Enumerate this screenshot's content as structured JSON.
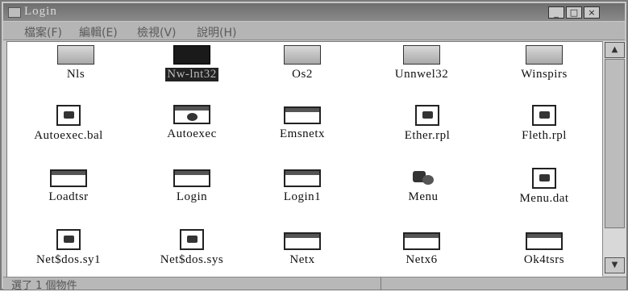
{
  "window": {
    "title": "Login"
  },
  "menubar": {
    "items": [
      "檔案(F)",
      "編輯(E)",
      "檢視(V)",
      "說明(H)"
    ]
  },
  "files": [
    {
      "label": "Nls",
      "icon": "folder-icon"
    },
    {
      "label": "Nw-lnt32",
      "icon": "folder-icon"
    },
    {
      "label": "Os2",
      "icon": "folder-icon"
    },
    {
      "label": "Unnwel32",
      "icon": "folder-icon"
    },
    {
      "label": "Winspirs",
      "icon": "folder-icon"
    },
    {
      "label": "Autoexec.bal",
      "icon": "document-icon"
    },
    {
      "label": "Autoexec",
      "icon": "msdos-program-icon"
    },
    {
      "label": "Emsnetx",
      "icon": "program-icon"
    },
    {
      "label": "Ether.rpl",
      "icon": "document-icon"
    },
    {
      "label": "Fleth.rpl",
      "icon": "document-icon"
    },
    {
      "label": "Loadtsr",
      "icon": "program-icon"
    },
    {
      "label": "Login",
      "icon": "program-icon"
    },
    {
      "label": "Login1",
      "icon": "program-icon"
    },
    {
      "label": "Menu",
      "icon": "shortcut-icon"
    },
    {
      "label": "Menu.dat",
      "icon": "document-icon"
    },
    {
      "label": "Net$dos.sy1",
      "icon": "document-icon"
    },
    {
      "label": "Net$dos.sys",
      "icon": "system-file-icon"
    },
    {
      "label": "Netx",
      "icon": "program-icon"
    },
    {
      "label": "Netx6",
      "icon": "program-icon"
    },
    {
      "label": "Ok4tsrs",
      "icon": "program-icon"
    }
  ],
  "status": {
    "text": "選了 1 個物件"
  }
}
